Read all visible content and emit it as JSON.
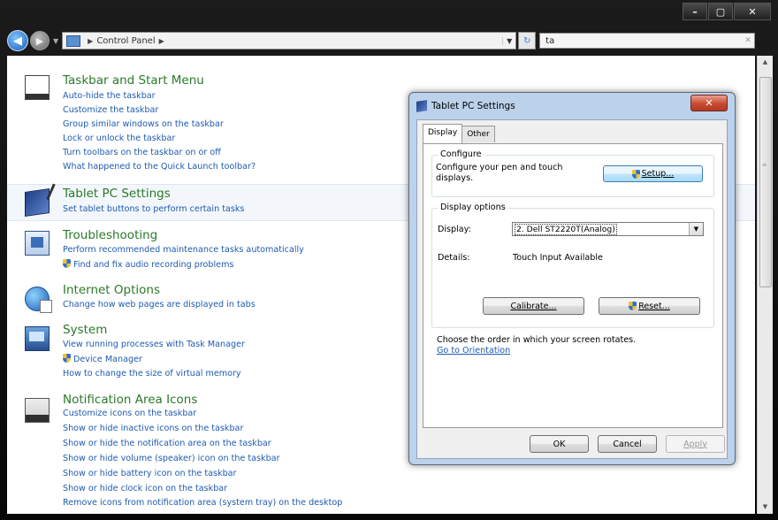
{
  "window": {
    "minimize_label": "–",
    "maximize_label": "▢",
    "close_label": "✕"
  },
  "navbar": {
    "back_icon": "◀",
    "forward_icon": "▶",
    "address_path": "Control Panel",
    "refresh_icon": "↻",
    "search_value": "ta",
    "search_clear": "✕"
  },
  "categories": [
    {
      "title": "Taskbar and Start Menu",
      "icon": "taskbar-icon",
      "links": [
        {
          "text": "Auto-hide the taskbar"
        },
        {
          "text": "Customize the taskbar"
        },
        {
          "text": "Group similar windows on the taskbar"
        },
        {
          "text": "Lock or unlock the taskbar"
        },
        {
          "text": "Turn toolbars on the taskbar on or off"
        },
        {
          "text": "What happened to the Quick Launch toolbar?"
        }
      ]
    },
    {
      "title": "Tablet PC Settings",
      "icon": "tablet-pc-icon",
      "links": [
        {
          "text": "Set tablet buttons to perform certain tasks"
        }
      ]
    },
    {
      "title": "Troubleshooting",
      "icon": "troubleshooting-icon",
      "links": [
        {
          "text": "Perform recommended maintenance tasks automatically"
        },
        {
          "text": "Find and fix audio recording problems",
          "shield": true
        }
      ]
    },
    {
      "title": "Internet Options",
      "icon": "internet-options-icon",
      "links": [
        {
          "text": "Change how web pages are displayed in tabs"
        }
      ]
    },
    {
      "title": "System",
      "icon": "system-icon",
      "links": [
        {
          "text": "View running processes with Task Manager"
        },
        {
          "text": "Device Manager",
          "shield": true
        },
        {
          "text": "How to change the size of virtual memory"
        }
      ]
    },
    {
      "title": "Notification Area Icons",
      "icon": "notification-area-icon",
      "links": [
        {
          "text": "Customize icons on the taskbar"
        },
        {
          "text": "Show or hide inactive icons on the taskbar"
        },
        {
          "text": "Show or hide the notification area on the taskbar"
        },
        {
          "text": "Show or hide volume (speaker) icon on the taskbar"
        },
        {
          "text": "Show or hide battery icon on the taskbar"
        },
        {
          "text": "Show or hide clock icon on the taskbar"
        },
        {
          "text": "Remove icons from notification area (system tray) on the desktop"
        }
      ]
    }
  ],
  "dialog": {
    "title": "Tablet PC Settings",
    "close_label": "✕",
    "tabs": [
      {
        "label": "Display",
        "active": true
      },
      {
        "label": "Other",
        "active": false
      }
    ],
    "configure": {
      "group_label": "Configure",
      "description": "Configure your pen and touch displays.",
      "description_line1": "Configure your pen and touch",
      "description_line2": "displays.",
      "setup_label": "Setup..."
    },
    "display_options": {
      "group_label": "Display options",
      "display_label": "Display:",
      "display_value": "2. Dell ST2220T(Analog)",
      "details_label": "Details:",
      "details_value": "Touch Input Available",
      "calibrate_label": "Calibrate...",
      "reset_label": "Reset..."
    },
    "orientation_text": "Choose the order in which your screen rotates.",
    "orientation_link": "Go to Orientation",
    "ok_label": "OK",
    "cancel_label": "Cancel",
    "apply_label": "Apply"
  },
  "colors": {
    "link": "#1f5bb0",
    "category_title": "#2a7a2a",
    "dialog_frame": "#bcd1ea"
  }
}
